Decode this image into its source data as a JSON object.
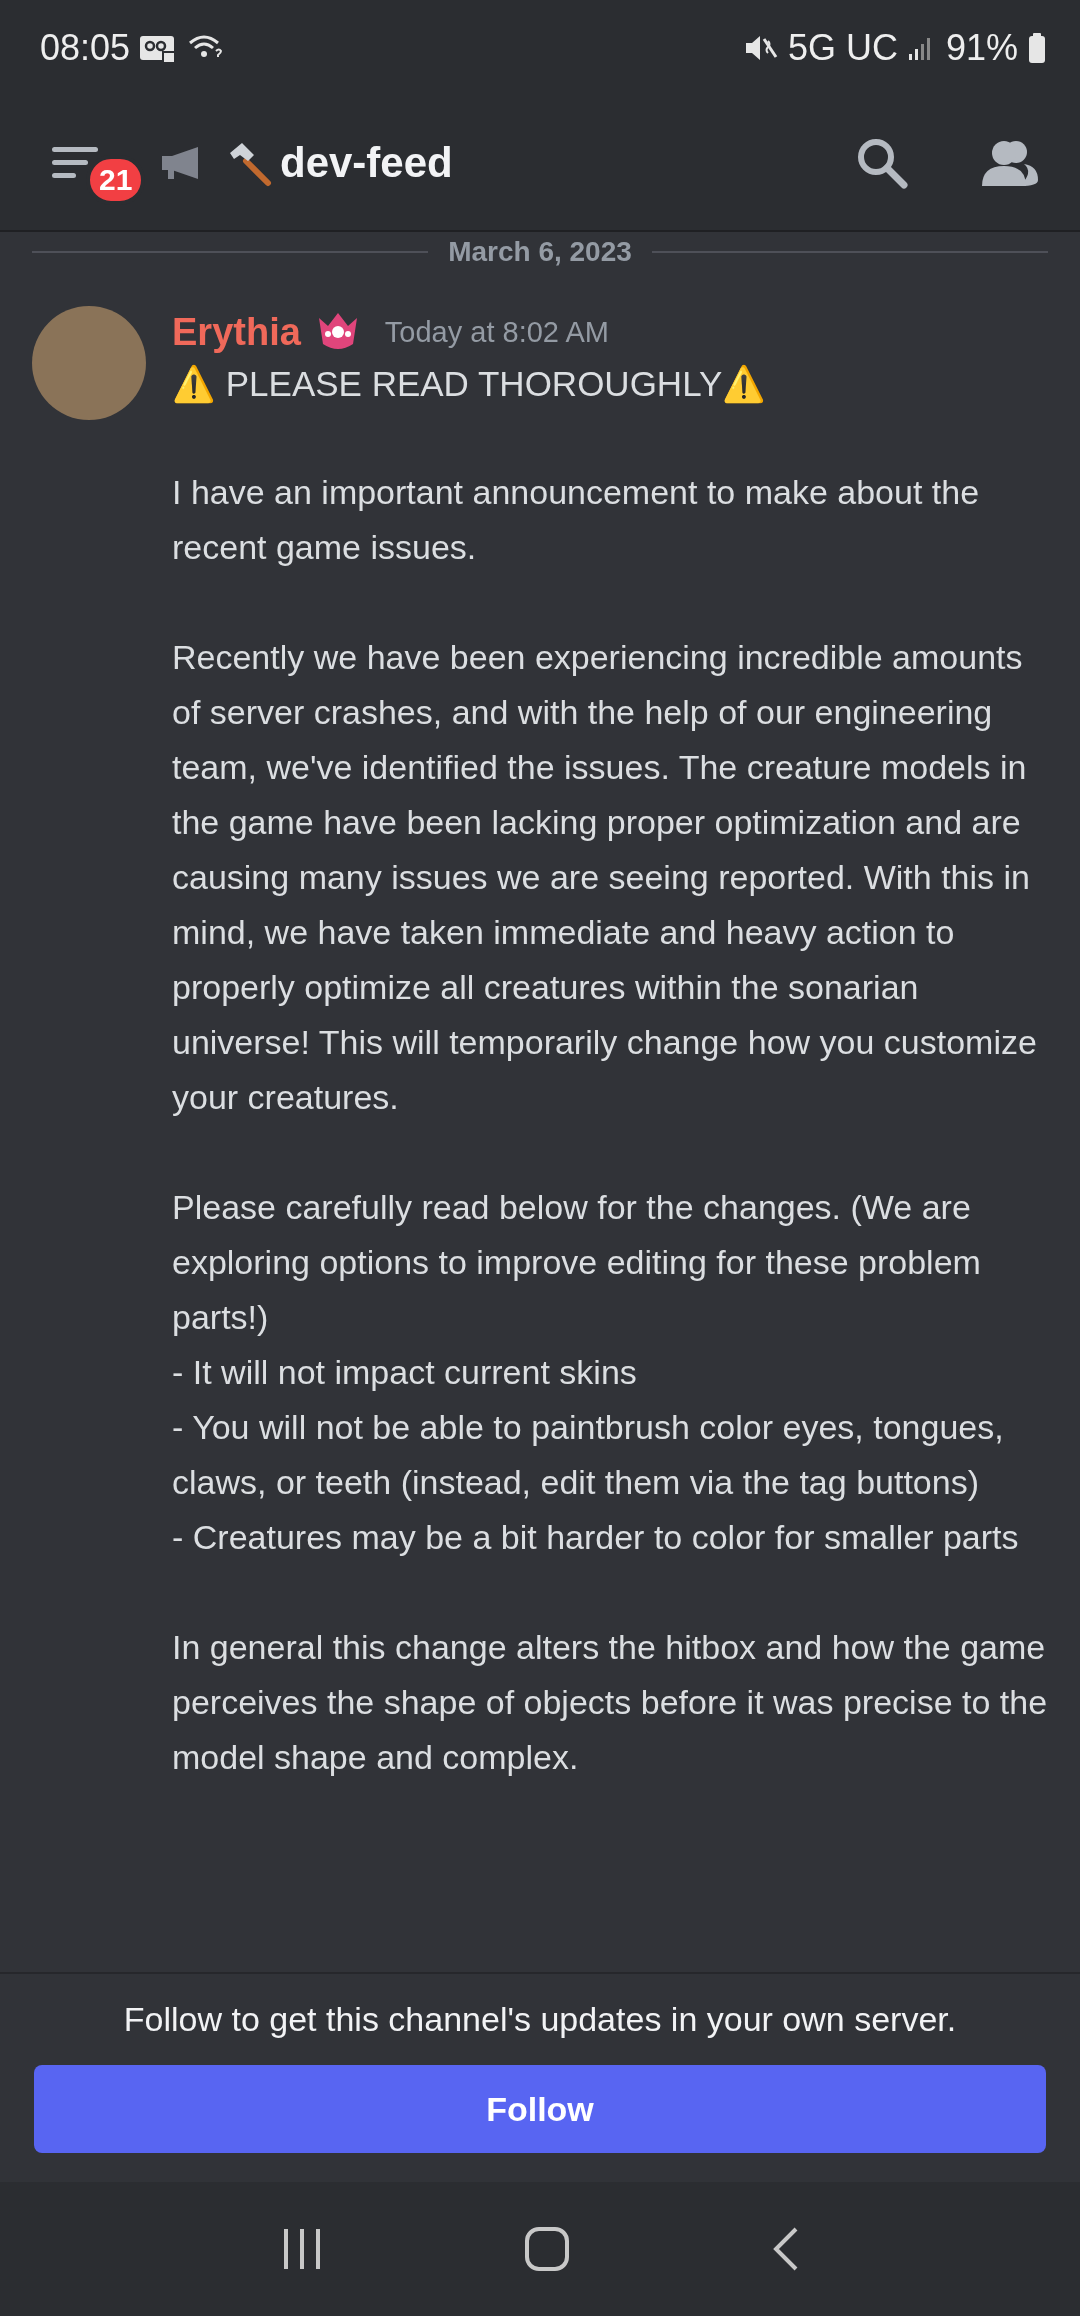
{
  "status_bar": {
    "time": "08:05",
    "network": "5G UC",
    "battery": "91%"
  },
  "header": {
    "unread_badge": "21",
    "channel": "dev-feed"
  },
  "date_divider": "March 6, 2023",
  "message": {
    "author": "Erythia",
    "timestamp": "Today at 8:02 AM",
    "title": "⚠️ PLEASE READ THOROUGHLY⚠️",
    "paragraphs": [
      {
        "lines": [
          "I have an important announcement to make about the recent game issues."
        ]
      },
      {
        "lines": [
          "Recently we have been experiencing incredible amounts of server crashes, and with the help of our engineering team, we've identified the issues. The creature models in the game have been lacking proper optimization and are causing many issues we are seeing reported. With this in mind, we have taken immediate and heavy action to properly optimize all creatures within the sonarian universe! This will temporarily change how you customize your creatures."
        ]
      },
      {
        "lines": [
          "Please carefully read below for the changes. (We are exploring options to improve editing for these problem parts!)",
          "- It will not impact current skins",
          "- You will not be able to paintbrush color eyes, tongues, claws, or teeth (instead, edit them via the tag buttons)",
          "- Creatures may be a bit harder to color for smaller parts"
        ]
      },
      {
        "lines": [
          "In general this change alters the hitbox and how the game perceives the shape of objects before it was precise to the model shape and complex."
        ]
      }
    ]
  },
  "follow_panel": {
    "prompt": "Follow to get this channel's updates in your own server.",
    "button": "Follow"
  }
}
